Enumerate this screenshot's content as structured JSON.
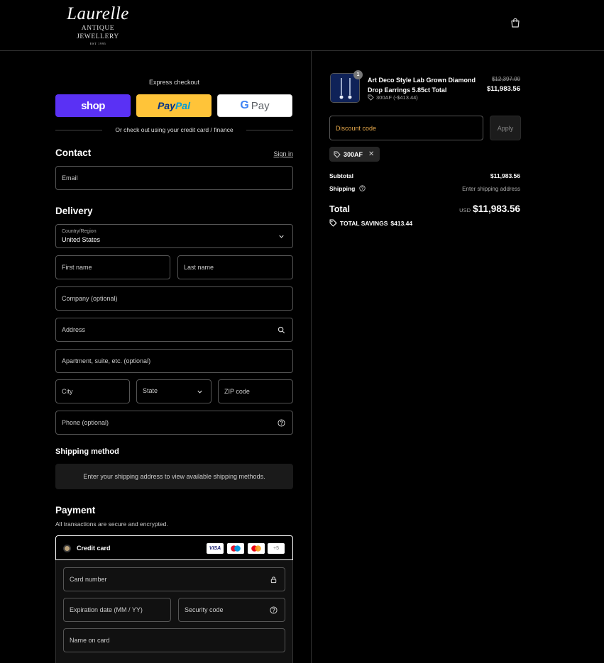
{
  "brand": {
    "name": "Laurelle",
    "subtitle": "ANTIQUE JEWELLERY",
    "est": "EST 1995"
  },
  "express": {
    "title": "Express checkout",
    "shop_label": "shop",
    "paypal_label_1": "Pay",
    "paypal_label_2": "Pal",
    "gpay_g": "G",
    "gpay_label": "Pay",
    "or_text": "Or check out using your credit card / finance"
  },
  "contact": {
    "title": "Contact",
    "signin": "Sign in",
    "email_placeholder": "Email"
  },
  "delivery": {
    "title": "Delivery",
    "country_label": "Country/Region",
    "country_value": "United States",
    "first_name": "First name",
    "last_name": "Last name",
    "company": "Company (optional)",
    "address": "Address",
    "apartment": "Apartment, suite, etc. (optional)",
    "city": "City",
    "state": "State",
    "zip": "ZIP code",
    "phone": "Phone (optional)"
  },
  "shipping_method": {
    "title": "Shipping method",
    "message": "Enter your shipping address to view available shipping methods."
  },
  "payment": {
    "title": "Payment",
    "subtitle": "All transactions are secure and encrypted.",
    "method_label": "Credit card",
    "visa": "VISA",
    "more_cards": "+5",
    "card_number": "Card number",
    "expiration": "Expiration date (MM / YY)",
    "security_code": "Security code",
    "name_on_card": "Name on card"
  },
  "order": {
    "product_name": "Art Deco Style Lab Grown Diamond Drop Earrings 5.85ct Total",
    "quantity": "1",
    "discount_line": "300AF (-$413.44)",
    "original_price": "$12,397.00",
    "price": "$11,983.56",
    "discount_placeholder": "Discount code",
    "apply_label": "Apply",
    "applied_code": "300AF",
    "subtotal_label": "Subtotal",
    "subtotal_value": "$11,983.56",
    "shipping_label": "Shipping",
    "shipping_value": "Enter shipping address",
    "total_label": "Total",
    "currency": "USD",
    "total_value": "$11,983.56",
    "savings_label": "TOTAL SAVINGS",
    "savings_value": "$413.44"
  }
}
